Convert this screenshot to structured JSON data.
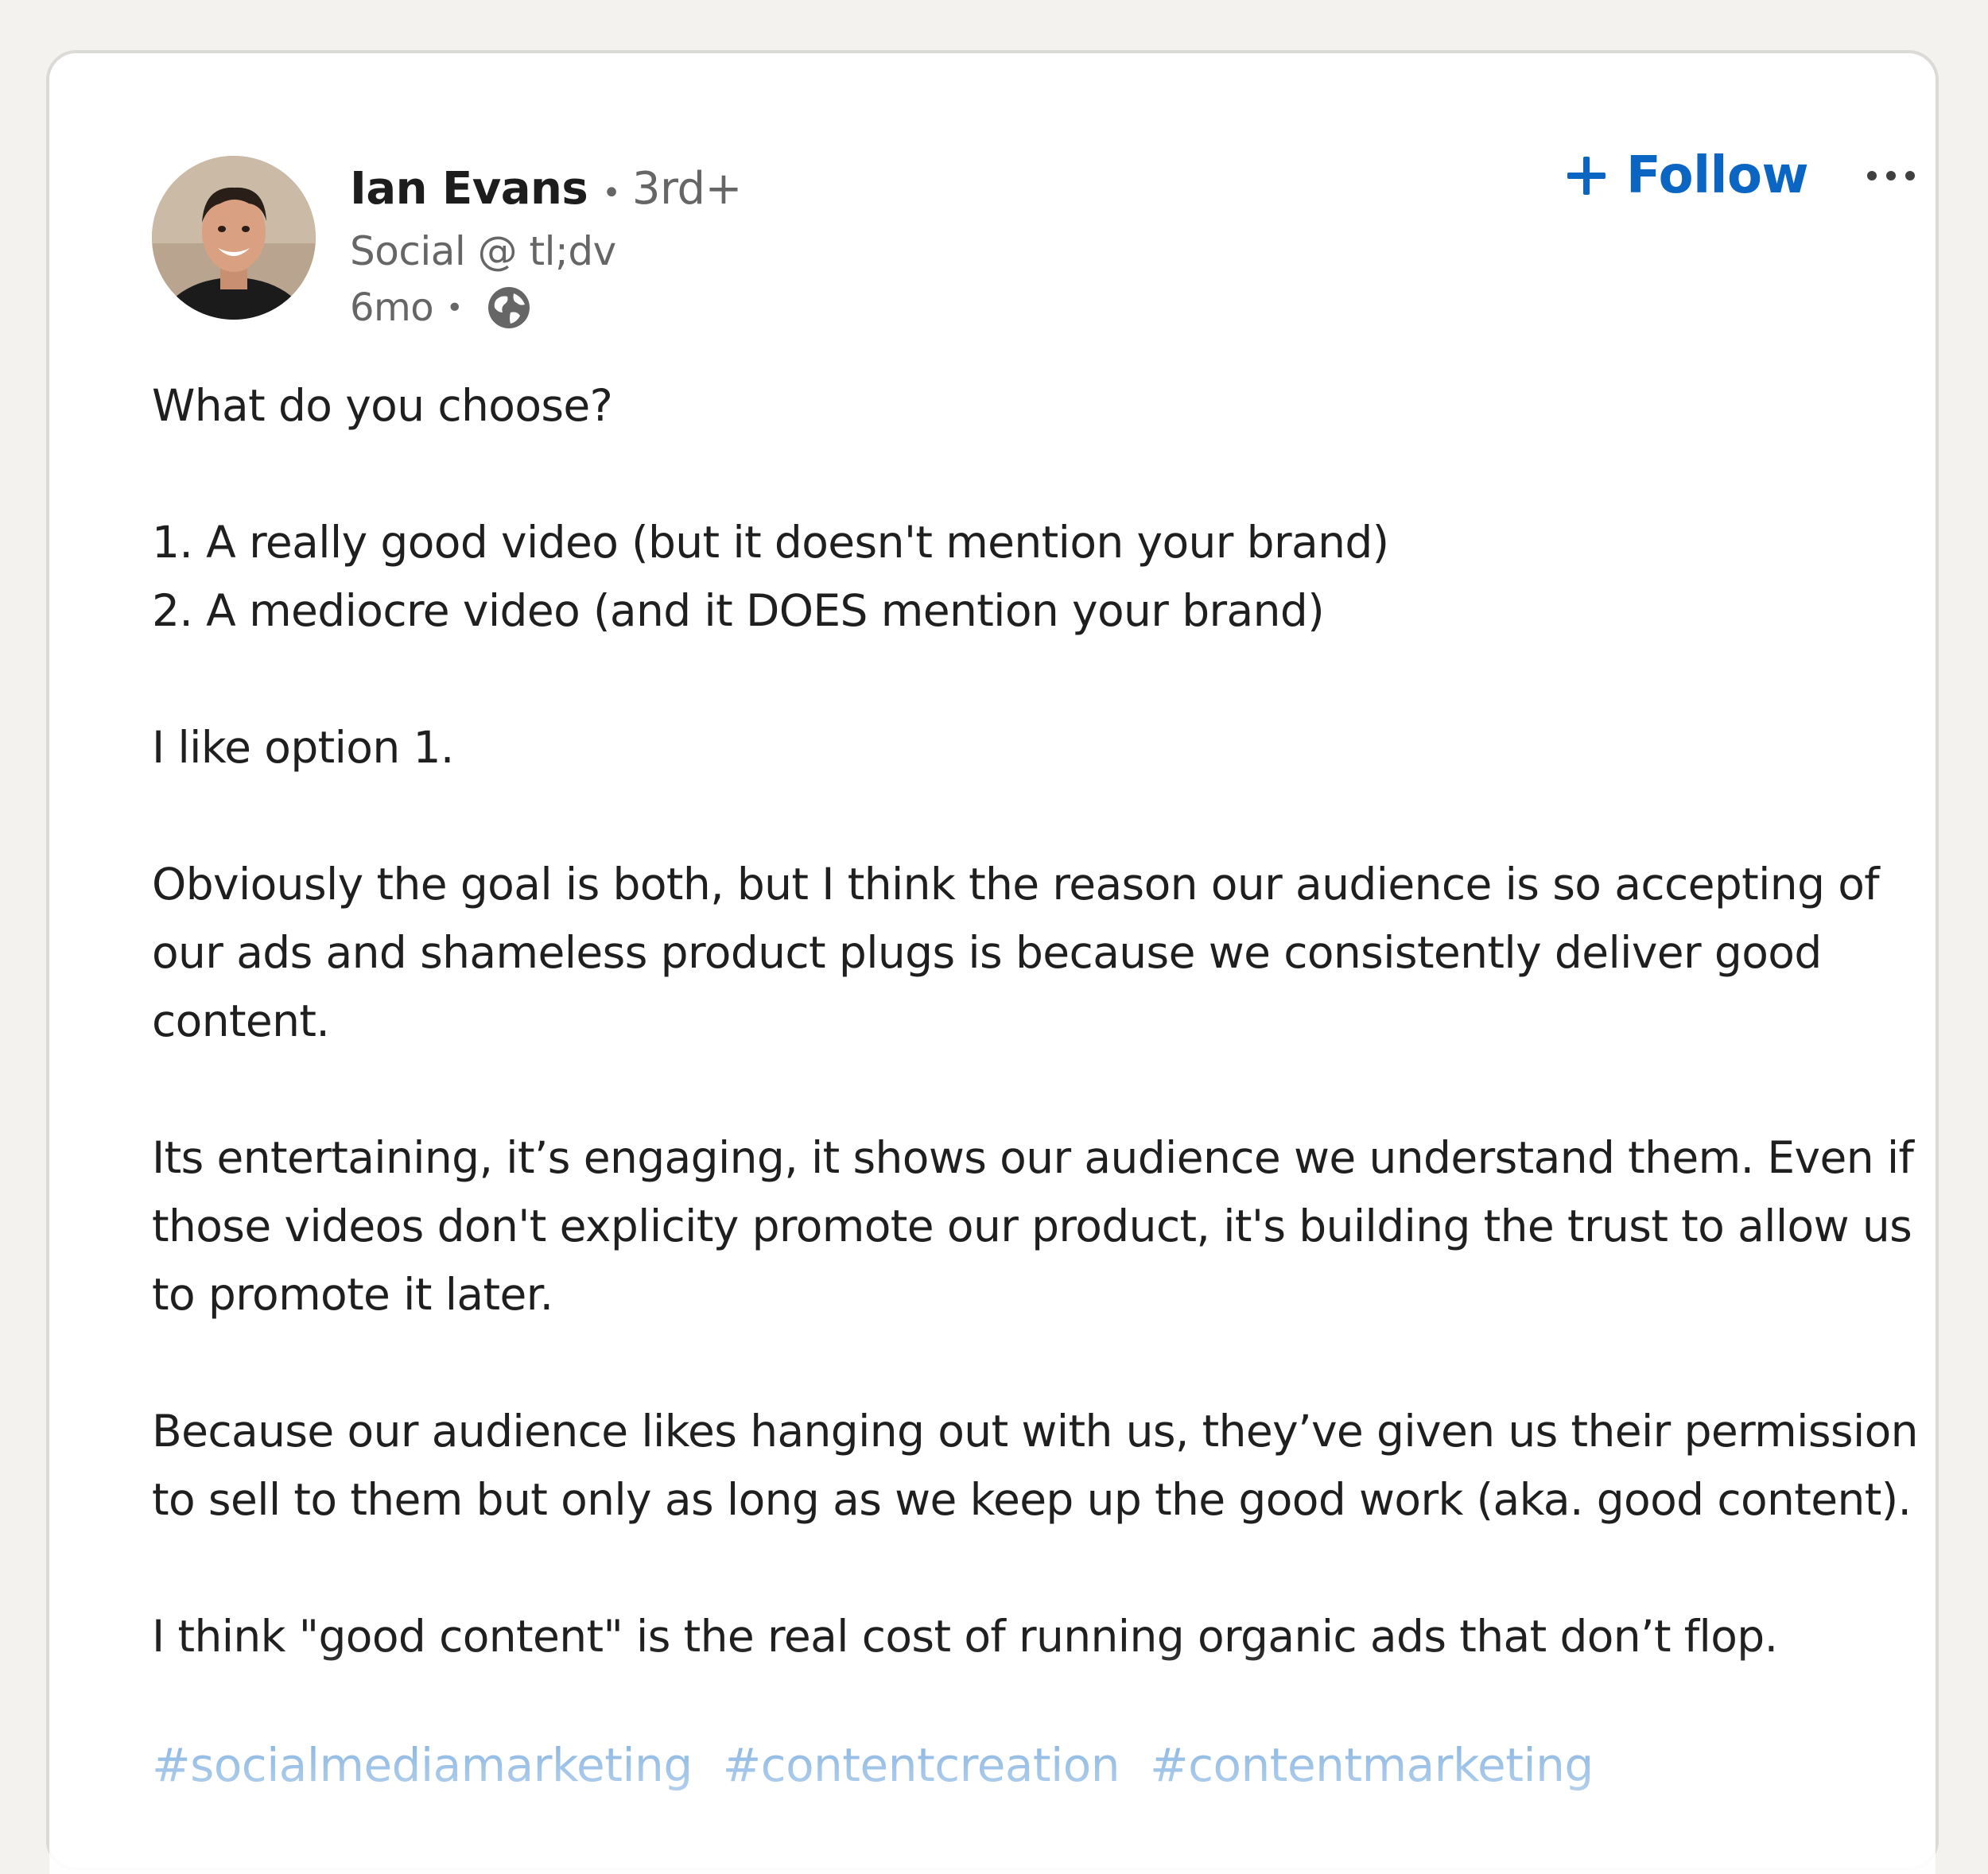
{
  "post": {
    "author": {
      "name": "Ian Evans",
      "degree_separator": "•",
      "degree": "3rd+",
      "headline": "Social @ tl;dv",
      "time": "6mo",
      "time_separator": "•",
      "visibility_icon": "globe-icon",
      "avatar_icon": "profile-photo"
    },
    "actions": {
      "follow_icon": "plus-icon",
      "follow_label": "Follow",
      "more_icon": "ellipsis-icon"
    },
    "body": {
      "question": "What do you choose?",
      "options": [
        "1. A really good video (but it doesn't mention your brand)",
        "2. A mediocre video (and it DOES mention your brand)"
      ],
      "choice": "I like option 1.",
      "paragraph_1_lines": [
        "Obviously the goal is both, but I think the reason our audience is so accepting of",
        "our ads and shameless product plugs is because we consistently deliver good",
        "content."
      ],
      "paragraph_2_lines": [
        "Its entertaining, it’s engaging, it shows our audience we understand them. Even if",
        "those videos don't explicity promote our product, it's building the trust to allow us",
        "to promote it later."
      ],
      "paragraph_3_lines": [
        "Because our audience likes hanging out with us, they’ve given us their permission",
        "to sell to them but only as long as we keep up the good work (aka. good content)."
      ],
      "closing": "I think \"good content\" is the real cost of running organic ads that don’t flop."
    },
    "hashtags": [
      "#socialmediamarketing",
      "#contentcreation",
      "#contentmarketing"
    ],
    "colors": {
      "accent": "#0a66c2",
      "text": "#1f1f1f",
      "muted": "#666666",
      "background": "#f3f2ef",
      "card": "#ffffff"
    }
  }
}
